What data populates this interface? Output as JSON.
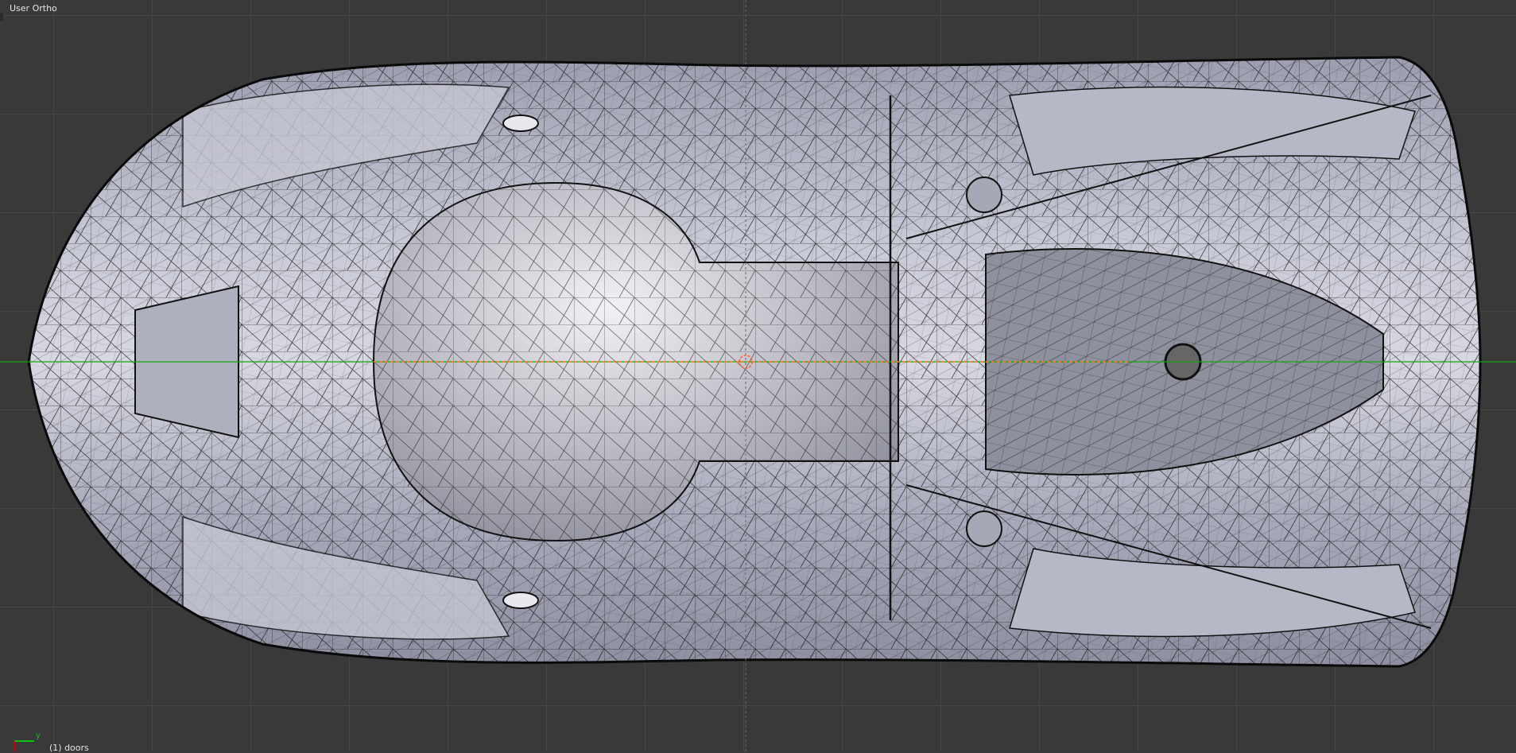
{
  "viewport": {
    "view_name": "User Ortho",
    "active_object": "(1) doors",
    "axis_labels": {
      "y": "y"
    },
    "colors": {
      "background": "#393939",
      "grid": "#474747",
      "x_axis": "#d00000",
      "y_axis": "#00b000",
      "mesh_fill": "#b8b9c8",
      "wire": "#0a0a0a",
      "selection_line": "#ff7a1a"
    }
  }
}
